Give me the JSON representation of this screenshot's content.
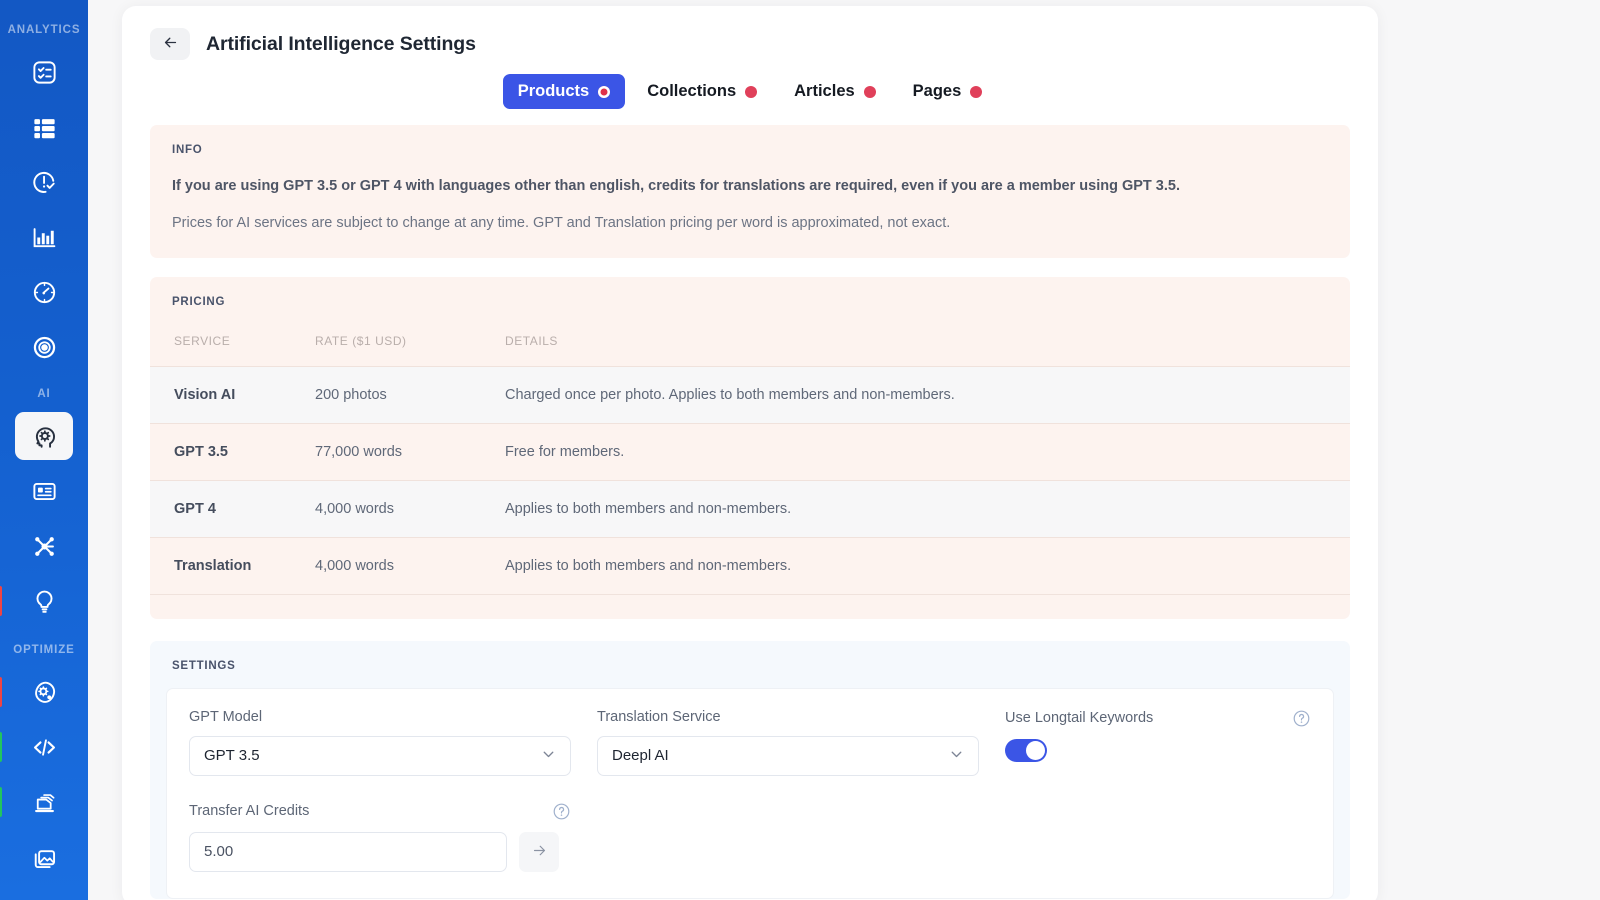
{
  "sidebar": {
    "groups": [
      {
        "label": "ANALYTICS",
        "items": [
          {
            "name": "checklist-icon",
            "marker": ""
          },
          {
            "name": "list-rows-icon",
            "marker": ""
          },
          {
            "name": "alert-clock-icon",
            "marker": ""
          },
          {
            "name": "bar-chart-icon",
            "marker": ""
          },
          {
            "name": "speedometer-icon",
            "marker": ""
          },
          {
            "name": "target-icon",
            "marker": ""
          }
        ]
      },
      {
        "label": "AI",
        "items": [
          {
            "name": "ai-brain-gear-icon",
            "marker": "",
            "active": true
          },
          {
            "name": "id-card-icon",
            "marker": ""
          },
          {
            "name": "network-nodes-icon",
            "marker": ""
          },
          {
            "name": "lightbulb-icon",
            "marker": "red"
          }
        ]
      },
      {
        "label": "OPTIMIZE",
        "items": [
          {
            "name": "settings-blob-icon",
            "marker": "red"
          },
          {
            "name": "code-brackets-icon",
            "marker": "green"
          },
          {
            "name": "stacked-pages-icon",
            "marker": "green"
          },
          {
            "name": "image-stack-icon",
            "marker": ""
          }
        ]
      }
    ]
  },
  "header": {
    "back_label": "←",
    "title": "Artificial Intelligence Settings"
  },
  "tabs": [
    {
      "label": "Products",
      "active": true
    },
    {
      "label": "Collections",
      "active": false
    },
    {
      "label": "Articles",
      "active": false
    },
    {
      "label": "Pages",
      "active": false
    }
  ],
  "info": {
    "label": "INFO",
    "strong": "If you are using GPT 3.5 or GPT 4 with languages other than english, credits for translations are required, even if you are a member using GPT 3.5.",
    "sub": "Prices for AI services are subject to change at any time. GPT and Translation pricing per word is approximated, not exact."
  },
  "pricing": {
    "label": "PRICING",
    "columns": [
      "SERVICE",
      "RATE ($1 USD)",
      "DETAILS"
    ],
    "rows": [
      {
        "service": "Vision AI",
        "rate": "200 photos",
        "details": "Charged once per photo. Applies to both members and non-members."
      },
      {
        "service": "GPT 3.5",
        "rate": "77,000 words",
        "details": "Free for members."
      },
      {
        "service": "GPT 4",
        "rate": "4,000 words",
        "details": "Applies to both members and non-members."
      },
      {
        "service": "Translation",
        "rate": "4,000 words",
        "details": "Applies to both members and non-members."
      }
    ]
  },
  "settings": {
    "label": "SETTINGS",
    "gpt_model": {
      "label": "GPT Model",
      "value": "GPT 3.5"
    },
    "translation_service": {
      "label": "Translation Service",
      "value": "Deepl AI"
    },
    "longtail": {
      "label": "Use Longtail Keywords",
      "enabled": true
    },
    "transfer_credits": {
      "label": "Transfer AI Credits",
      "value": "5.00"
    }
  },
  "colors": {
    "sidebar_top": "#1358c4",
    "sidebar_bottom": "#1a6ee0",
    "accent": "#3b55e6",
    "dot_red": "#e0405a",
    "marker_red": "#ef4444",
    "marker_green": "#22c55e",
    "panel_warm": "#fdf3ef",
    "panel_cool": "#f5f9fd"
  }
}
